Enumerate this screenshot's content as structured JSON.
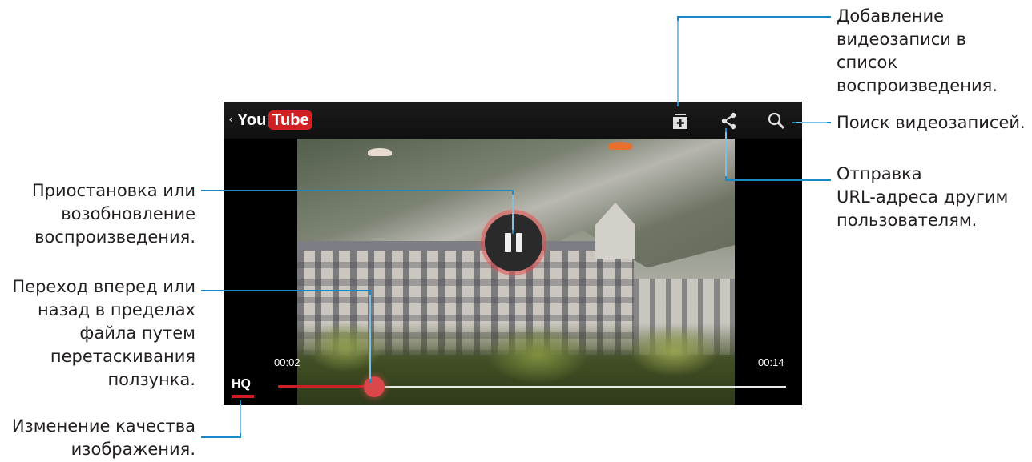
{
  "player": {
    "app_name_you": "You",
    "app_name_tube": "Tube",
    "time_current": "00:02",
    "time_total": "00:14",
    "quality_label": "HQ",
    "progress_fraction": 0.19,
    "accent_color": "#d02024"
  },
  "icons": {
    "back": "chevron-left-icon",
    "add_to_playlist": "add-to-playlist-icon",
    "share": "share-icon",
    "search": "search-icon",
    "pause": "pause-icon"
  },
  "callouts": {
    "add_playlist": "Добавление\nвидеозаписи в\nсписок\nвоспроизведения.",
    "search": "Поиск видеозаписей.",
    "share": "Отправка\nURL-адреса другим\nпользователям.",
    "pause": "Приостановка или\nвозобновление\nвоспроизведения.",
    "seek": "Переход вперед или\nназад в пределах\nфайла путем\nперетаскивания\nползунка.",
    "quality": "Изменение качества\nизображения."
  }
}
